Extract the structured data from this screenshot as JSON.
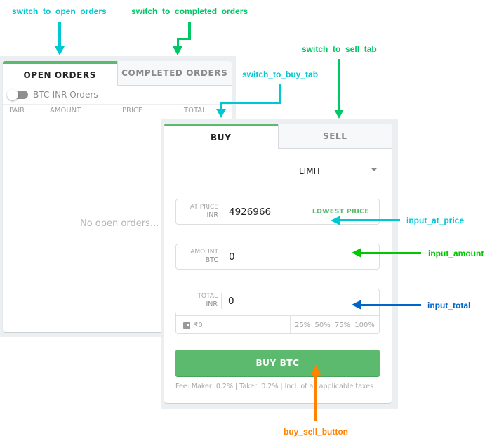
{
  "orders_panel": {
    "tabs": [
      {
        "label": "OPEN ORDERS",
        "active": true
      },
      {
        "label": "COMPLETED ORDERS",
        "active": false
      }
    ],
    "filter_toggle_label": "BTC-INR Orders",
    "filter_toggle_on": false,
    "columns": [
      "PAIR",
      "AMOUNT",
      "PRICE",
      "TOTAL"
    ],
    "empty_message": "No open orders..."
  },
  "trade_panel": {
    "tabs": [
      {
        "label": "BUY",
        "active": true
      },
      {
        "label": "SELL",
        "active": false
      }
    ],
    "order_type": "LIMIT",
    "price_field": {
      "label": "AT PRICE",
      "unit": "INR",
      "value": "4926966",
      "action_label": "LOWEST PRICE"
    },
    "amount_field": {
      "label": "AMOUNT",
      "unit": "BTC",
      "value": "0"
    },
    "total_field": {
      "label": "TOTAL",
      "unit": "INR",
      "value": "0"
    },
    "wallet_balance": "₹0",
    "percent_options": [
      "25%",
      "50%",
      "75%",
      "100%"
    ],
    "submit_label": "BUY BTC",
    "fee_note": "Fee: Maker: 0.2% | Taker: 0.2% | Incl. of all applicable taxes"
  },
  "annotations": {
    "switch_to_open_orders": "switch_to_open_orders",
    "switch_to_completed_orders": "switch_to_completed_orders",
    "switch_to_sell_tab": "switch_to_sell_tab",
    "switch_to_buy_tab": "switch_to_buy_tab",
    "input_at_price": "input_at_price",
    "input_amount": "input_amount",
    "input_total": "input_total",
    "buy_sell_button": "buy_sell_button"
  },
  "colors": {
    "accent_green": "#5cba6f",
    "annotation_cyan": "#00c8d2",
    "annotation_green": "#00c864",
    "annotation_bright_green": "#00c800",
    "annotation_blue": "#0064c8",
    "annotation_orange": "#ff8200"
  }
}
